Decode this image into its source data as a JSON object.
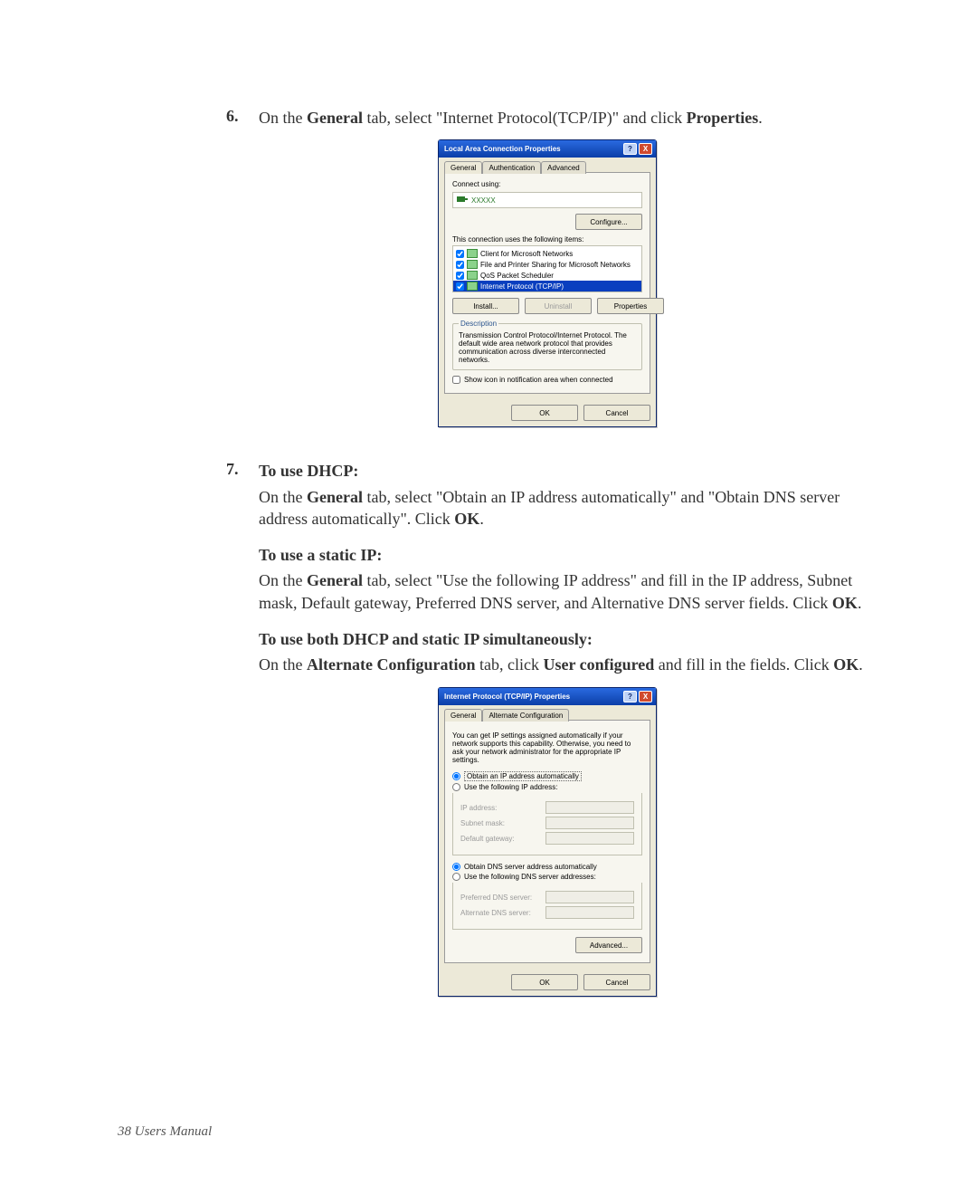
{
  "step6": {
    "num": "6.",
    "pre": "On the ",
    "b1": "General",
    "mid": " tab, select \"Internet Protocol(TCP/IP)\" and click ",
    "b2": "Properties",
    "end": "."
  },
  "dlg1": {
    "title": "Local Area Connection Properties",
    "help": "?",
    "close": "X",
    "tabs": [
      "General",
      "Authentication",
      "Advanced"
    ],
    "connect_label": "Connect using:",
    "adapter": "XXXXX",
    "configure": "Configure...",
    "list_label": "This connection uses the following items:",
    "items": [
      "Client for Microsoft Networks",
      "File and Printer Sharing for Microsoft Networks",
      "QoS Packet Scheduler",
      "Internet Protocol (TCP/IP)"
    ],
    "install": "Install...",
    "uninstall": "Uninstall",
    "properties": "Properties",
    "desc_legend": "Description",
    "desc_text": "Transmission Control Protocol/Internet Protocol. The default wide area network protocol that provides communication across diverse interconnected networks.",
    "showicon": "Show icon in notification area when connected",
    "ok": "OK",
    "cancel": "Cancel"
  },
  "step7": {
    "num": "7.",
    "h1": "To use DHCP:",
    "p1_pre": "On the ",
    "p1_b1": "General",
    "p1_mid": " tab, select \"Obtain an IP address automatically\" and \"Obtain DNS server address automatically\". Click ",
    "p1_b2": "OK",
    "p1_end": ".",
    "h2": "To use a static IP:",
    "p2_pre": "On the ",
    "p2_b1": "General",
    "p2_mid": " tab, select \"Use the following IP address\" and fill in the IP address, Subnet mask, Default gateway, Preferred DNS server, and Alternative DNS server fields. Click ",
    "p2_b2": "OK",
    "p2_end": ".",
    "h3": "To use both DHCP and static IP simultaneously:",
    "p3_pre": "On the ",
    "p3_b1": "Alternate Configuration",
    "p3_mid": " tab, click ",
    "p3_b2": "User configured",
    "p3_post": " and fill in the fields. Click ",
    "p3_b3": "OK",
    "p3_end": "."
  },
  "dlg2": {
    "title": "Internet Protocol (TCP/IP) Properties",
    "help": "?",
    "close": "X",
    "tabs": [
      "General",
      "Alternate Configuration"
    ],
    "intro": "You can get IP settings assigned automatically if your network supports this capability. Otherwise, you need to ask your network administrator for the appropriate IP settings.",
    "radio1": "Obtain an IP address automatically",
    "radio2": "Use the following IP address:",
    "ip_label": "IP address:",
    "mask_label": "Subnet mask:",
    "gw_label": "Default gateway:",
    "radio3": "Obtain DNS server address automatically",
    "radio4": "Use the following DNS server addresses:",
    "pdns_label": "Preferred DNS server:",
    "adns_label": "Alternate DNS server:",
    "advanced": "Advanced...",
    "ok": "OK",
    "cancel": "Cancel"
  },
  "footer": "38  Users Manual"
}
